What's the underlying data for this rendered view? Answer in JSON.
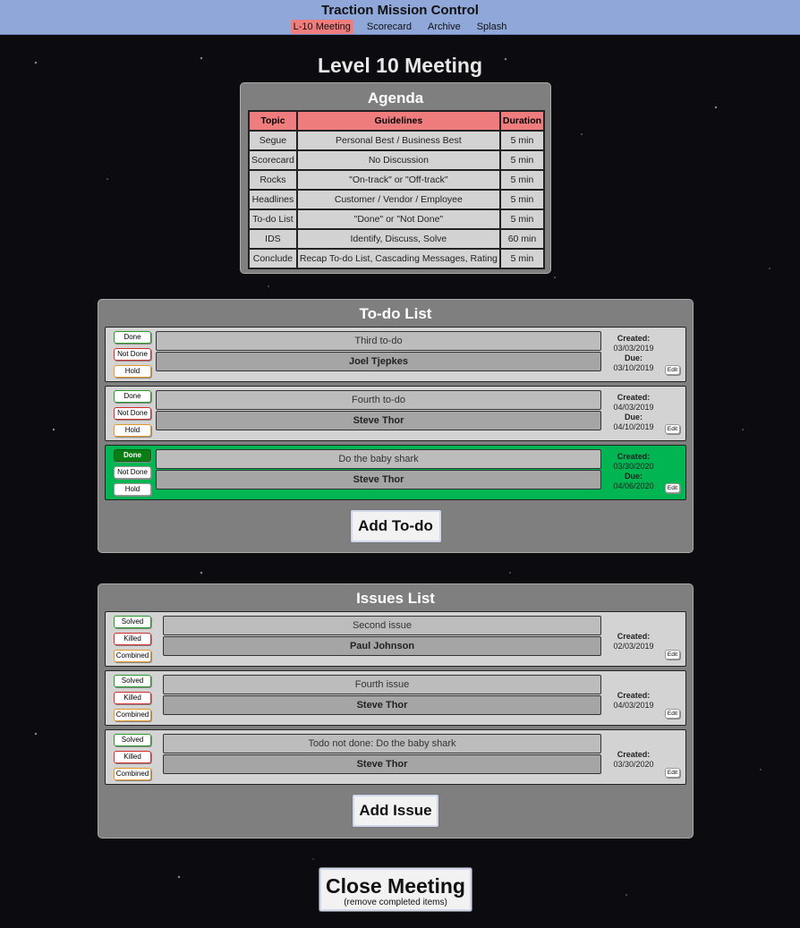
{
  "app": {
    "title": "Traction Mission Control",
    "nav": [
      "L-10 Meeting",
      "Scorecard",
      "Archive",
      "Splash"
    ]
  },
  "page": {
    "title": "Level 10 Meeting"
  },
  "agenda": {
    "title": "Agenda",
    "headers": [
      "Topic",
      "Guidelines",
      "Duration"
    ],
    "rows": [
      [
        "Segue",
        "Personal Best / Business Best",
        "5 min"
      ],
      [
        "Scorecard",
        "No Discussion",
        "5 min"
      ],
      [
        "Rocks",
        "\"On-track\" or \"Off-track\"",
        "5 min"
      ],
      [
        "Headlines",
        "Customer / Vendor / Employee",
        "5 min"
      ],
      [
        "To-do List",
        "\"Done\" or \"Not Done\"",
        "5 min"
      ],
      [
        "IDS",
        "Identify, Discuss, Solve",
        "60 min"
      ],
      [
        "Conclude",
        "Recap To-do List, Cascading Messages, Rating",
        "5 min"
      ]
    ]
  },
  "todo": {
    "title": "To-do List",
    "buttons": {
      "done": "Done",
      "not_done": "Not Done",
      "hold": "Hold"
    },
    "created_label": "Created:",
    "due_label": "Due:",
    "edit_label": "Edit",
    "add_label": "Add To-do",
    "items": [
      {
        "title": "Third to-do",
        "owner": "Joel Tjepkes",
        "created": "03/03/2019",
        "due": "03/10/2019"
      },
      {
        "title": "Fourth to-do",
        "owner": "Steve Thor",
        "created": "04/03/2019",
        "due": "04/10/2019"
      },
      {
        "title": "Do the baby shark",
        "owner": "Steve Thor",
        "created": "03/30/2020",
        "due": "04/06/2020"
      }
    ]
  },
  "issues": {
    "title": "Issues List",
    "buttons": {
      "solved": "Solved",
      "killed": "Killed",
      "combined": "Combined"
    },
    "created_label": "Created:",
    "edit_label": "Edit",
    "add_label": "Add Issue",
    "items": [
      {
        "title": "Second issue",
        "owner": "Paul Johnson",
        "created": "02/03/2019"
      },
      {
        "title": "Fourth issue",
        "owner": "Steve Thor",
        "created": "04/03/2019"
      },
      {
        "title": "Todo not done: Do the baby shark",
        "owner": "Steve Thor",
        "created": "03/30/2020"
      }
    ]
  },
  "close": {
    "label": "Close Meeting",
    "sub": "(remove completed items)"
  },
  "colors": {
    "header_bg": "#8fa7d9",
    "accent_red": "#f07d7d",
    "done_green": "#00b552",
    "panel_gray": "#7f7f7f"
  }
}
